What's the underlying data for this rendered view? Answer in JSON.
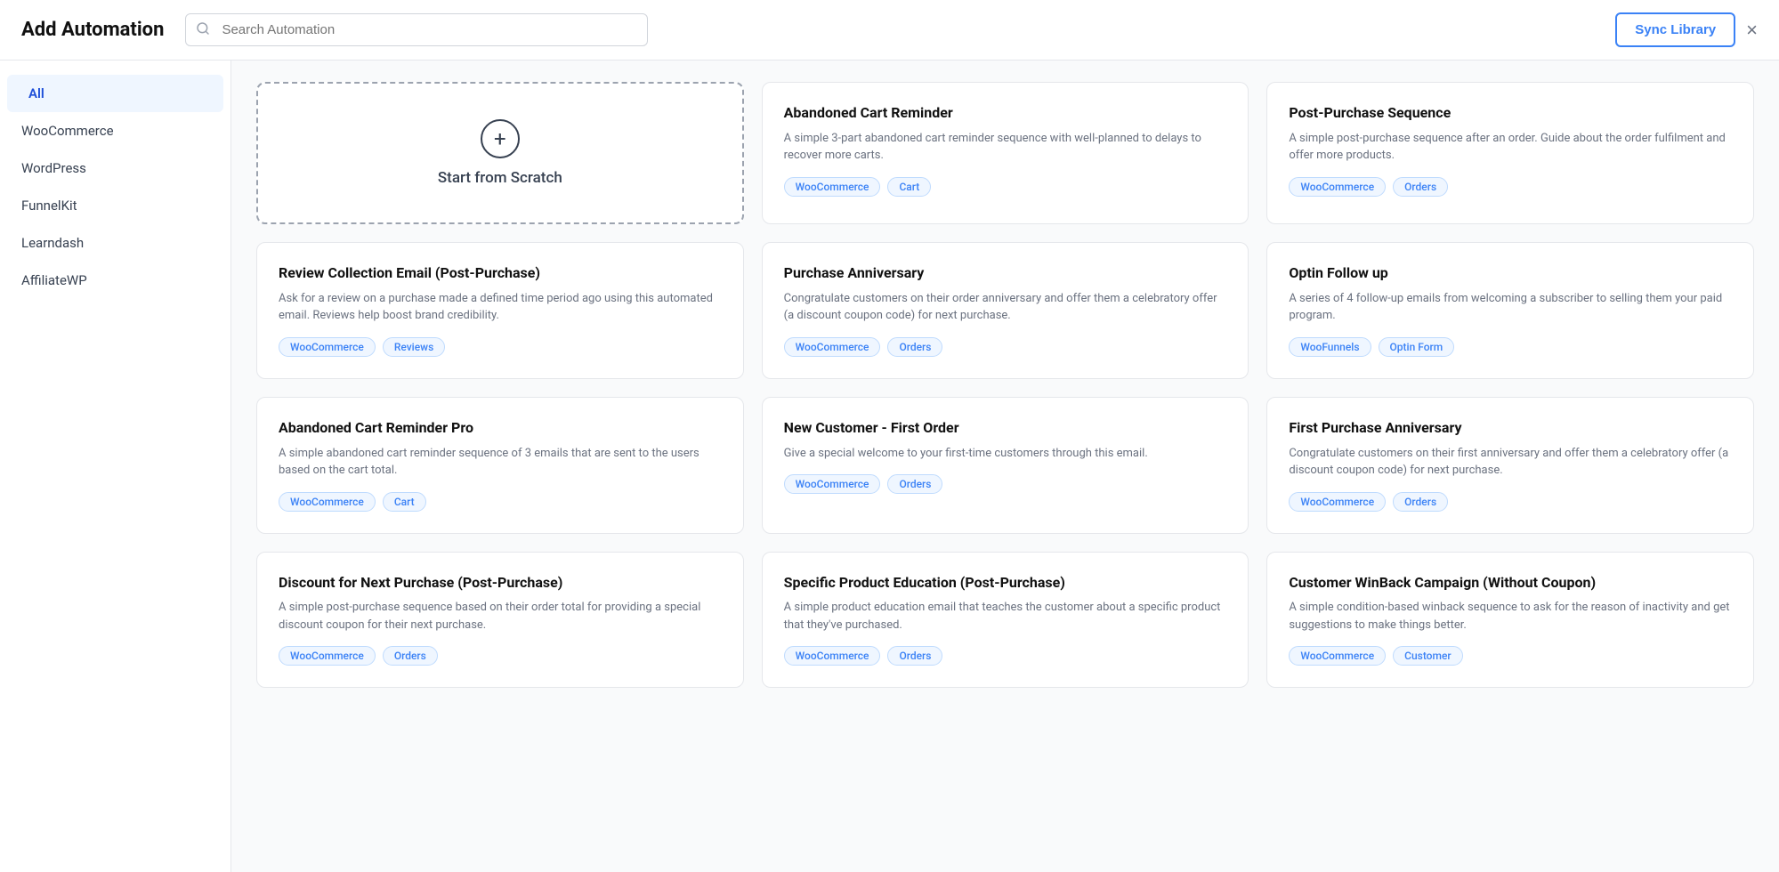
{
  "header": {
    "title": "Add Automation",
    "search_placeholder": "Search Automation",
    "sync_label": "Sync Library",
    "close_label": "×"
  },
  "sidebar": {
    "items": [
      {
        "id": "all",
        "label": "All",
        "active": true
      },
      {
        "id": "woocommerce",
        "label": "WooCommerce",
        "active": false
      },
      {
        "id": "wordpress",
        "label": "WordPress",
        "active": false
      },
      {
        "id": "funnelkit",
        "label": "FunnelKit",
        "active": false
      },
      {
        "id": "learndash",
        "label": "Learndash",
        "active": false
      },
      {
        "id": "affiliatewp",
        "label": "AffiliateWP",
        "active": false
      }
    ]
  },
  "scratch": {
    "label": "Start from Scratch",
    "plus_icon": "+"
  },
  "automations": [
    {
      "id": "abandoned-cart-reminder",
      "title": "Abandoned Cart Reminder",
      "desc": "A simple 3-part abandoned cart reminder sequence with well-planned to delays to recover more carts.",
      "tags": [
        "WooCommerce",
        "Cart"
      ]
    },
    {
      "id": "post-purchase-sequence",
      "title": "Post-Purchase Sequence",
      "desc": "A simple post-purchase sequence after an order. Guide about the order fulfilment and offer more products.",
      "tags": [
        "WooCommerce",
        "Orders"
      ]
    },
    {
      "id": "review-collection-email",
      "title": "Review Collection Email (Post-Purchase)",
      "desc": "Ask for a review on a purchase made a defined time period ago using this automated email. Reviews help boost brand credibility.",
      "tags": [
        "WooCommerce",
        "Reviews"
      ]
    },
    {
      "id": "purchase-anniversary",
      "title": "Purchase Anniversary",
      "desc": "Congratulate customers on their order anniversary and offer them a celebratory offer (a discount coupon code) for next purchase.",
      "tags": [
        "WooCommerce",
        "Orders"
      ]
    },
    {
      "id": "optin-follow-up",
      "title": "Optin Follow up",
      "desc": "A series of 4 follow-up emails from welcoming a subscriber to selling them your paid program.",
      "tags": [
        "WooFunnels",
        "Optin Form"
      ]
    },
    {
      "id": "abandoned-cart-reminder-pro",
      "title": "Abandoned Cart Reminder Pro",
      "desc": "A simple abandoned cart reminder sequence of 3 emails that are sent to the users based on the cart total.",
      "tags": [
        "WooCommerce",
        "Cart"
      ]
    },
    {
      "id": "new-customer-first-order",
      "title": "New Customer - First Order",
      "desc": "Give a special welcome to your first-time customers through this email.",
      "tags": [
        "WooCommerce",
        "Orders"
      ]
    },
    {
      "id": "first-purchase-anniversary",
      "title": "First Purchase Anniversary",
      "desc": "Congratulate customers on their first anniversary and offer them a celebratory offer (a discount coupon code) for next purchase.",
      "tags": [
        "WooCommerce",
        "Orders"
      ]
    },
    {
      "id": "discount-next-purchase",
      "title": "Discount for Next Purchase (Post-Purchase)",
      "desc": "A simple post-purchase sequence based on their order total for providing a special discount coupon for their next purchase.",
      "tags": [
        "WooCommerce",
        "Orders"
      ]
    },
    {
      "id": "specific-product-education",
      "title": "Specific Product Education (Post-Purchase)",
      "desc": "A simple product education email that teaches the customer about a specific product that they've purchased.",
      "tags": [
        "WooCommerce",
        "Orders"
      ]
    },
    {
      "id": "customer-winback",
      "title": "Customer WinBack Campaign (Without Coupon)",
      "desc": "A simple condition-based winback sequence to ask for the reason of inactivity and get suggestions to make things better.",
      "tags": [
        "WooCommerce",
        "Customer"
      ]
    }
  ]
}
